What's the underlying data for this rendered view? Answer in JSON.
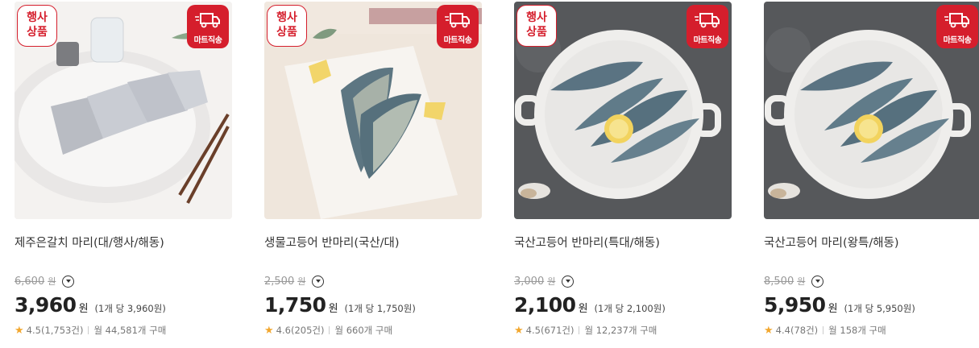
{
  "badges": {
    "event": "행사\n상품",
    "delivery": "마트직송"
  },
  "products": [
    {
      "name": "제주은갈치 마리(대/행사/해동)",
      "original_price": "6,600",
      "price": "3,960",
      "unit": "원",
      "unit_price": "(1개 당 3,960원)",
      "rating": "4.5",
      "reviews": "(1,753건)",
      "monthly": "월 44,581개 구매",
      "has_event_badge": true
    },
    {
      "name": "생물고등어 반마리(국산/대)",
      "original_price": "2,500",
      "price": "1,750",
      "unit": "원",
      "unit_price": "(1개 당 1,750원)",
      "rating": "4.6",
      "reviews": "(205건)",
      "monthly": "월 660개 구매",
      "has_event_badge": true
    },
    {
      "name": "국산고등어 반마리(특대/해동)",
      "original_price": "3,000",
      "price": "2,100",
      "unit": "원",
      "unit_price": "(1개 당 2,100원)",
      "rating": "4.5",
      "reviews": "(671건)",
      "monthly": "월 12,237개 구매",
      "has_event_badge": true
    },
    {
      "name": "국산고등어 마리(왕특/해동)",
      "original_price": "8,500",
      "price": "5,950",
      "unit": "원",
      "unit_price": "(1개 당 5,950원)",
      "rating": "4.4",
      "reviews": "(78건)",
      "monthly": "월 158개 구매",
      "has_event_badge": false
    }
  ],
  "icons": {
    "delivery": "truck-icon",
    "price_toggle": "chevron-down-icon",
    "rating": "star-icon"
  },
  "colors": {
    "accent": "#d51e2c",
    "star": "#f2a72e"
  }
}
